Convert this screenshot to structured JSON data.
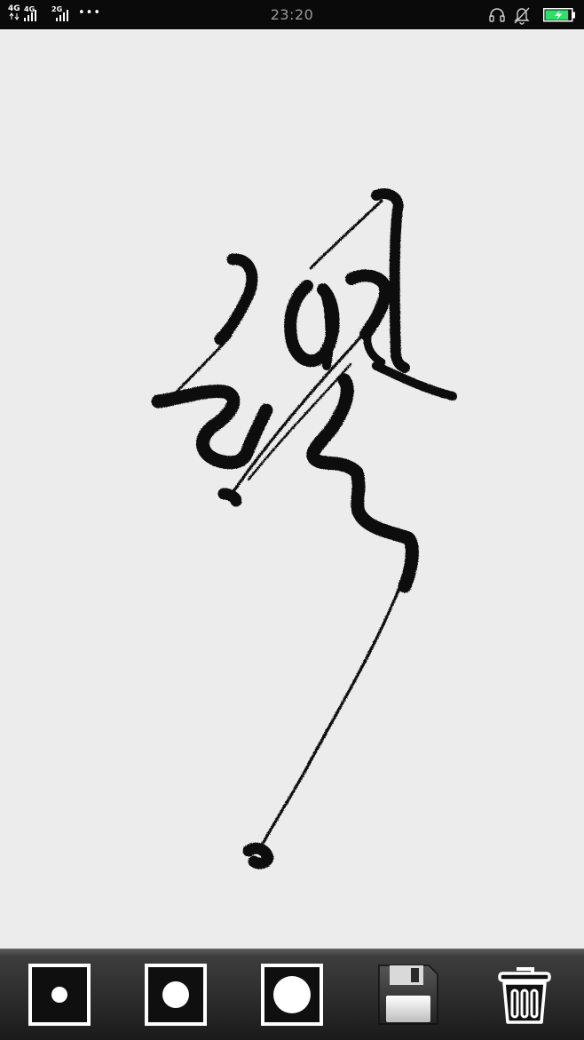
{
  "status_bar": {
    "network_1": "4G",
    "network_2": "4G",
    "network_3": "2G",
    "more": "•••",
    "time": "23:20",
    "icons": [
      "headset-icon",
      "mute-bell-icon",
      "battery-charging-icon"
    ],
    "battery_level": 0.9,
    "battery_color": "#2ee06a"
  },
  "canvas": {
    "background": "#ececec",
    "ink_color": "#111111"
  },
  "toolbar": {
    "tools": [
      {
        "name": "brush-small-button",
        "icon": "small-dot-icon"
      },
      {
        "name": "brush-medium-button",
        "icon": "medium-dot-icon"
      },
      {
        "name": "brush-large-button",
        "icon": "large-dot-icon"
      },
      {
        "name": "save-button",
        "icon": "floppy-disk-icon"
      },
      {
        "name": "clear-button",
        "icon": "trash-icon"
      }
    ]
  }
}
